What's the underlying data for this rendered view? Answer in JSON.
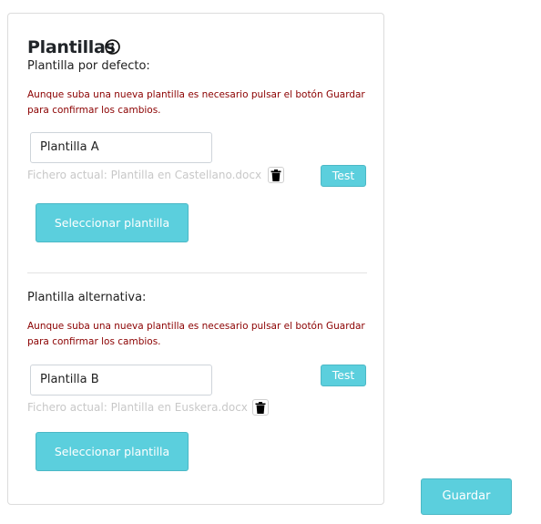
{
  "templates_section": {
    "title": "Plantillas",
    "info_icon": "info-circle-icon",
    "default": {
      "label": "Plantilla por defecto:",
      "warning": "Aunque suba una nueva plantilla es necesario pulsar el botón Guardar para confirmar los cambios.",
      "name_value": "Plantilla A",
      "current_file": "Fichero actual: Plantilla en Castellano.docx",
      "delete_icon": "trash-icon",
      "test_label": "Test",
      "select_label": "Seleccionar plantilla"
    },
    "alternative": {
      "label": "Plantilla alternativa:",
      "warning": "Aunque suba una nueva plantilla es necesario pulsar el botón Guardar para confirmar los cambios.",
      "name_value": "Plantilla B",
      "current_file": "Fichero actual: Plantilla en Euskera.docx",
      "delete_icon": "trash-icon",
      "test_label": "Test",
      "select_label": "Seleccionar plantilla"
    }
  },
  "save_label": "Guardar",
  "colors": {
    "accent": "#5bcfdd",
    "warning_text": "#8b0000",
    "muted_text": "#c8c8c8"
  }
}
